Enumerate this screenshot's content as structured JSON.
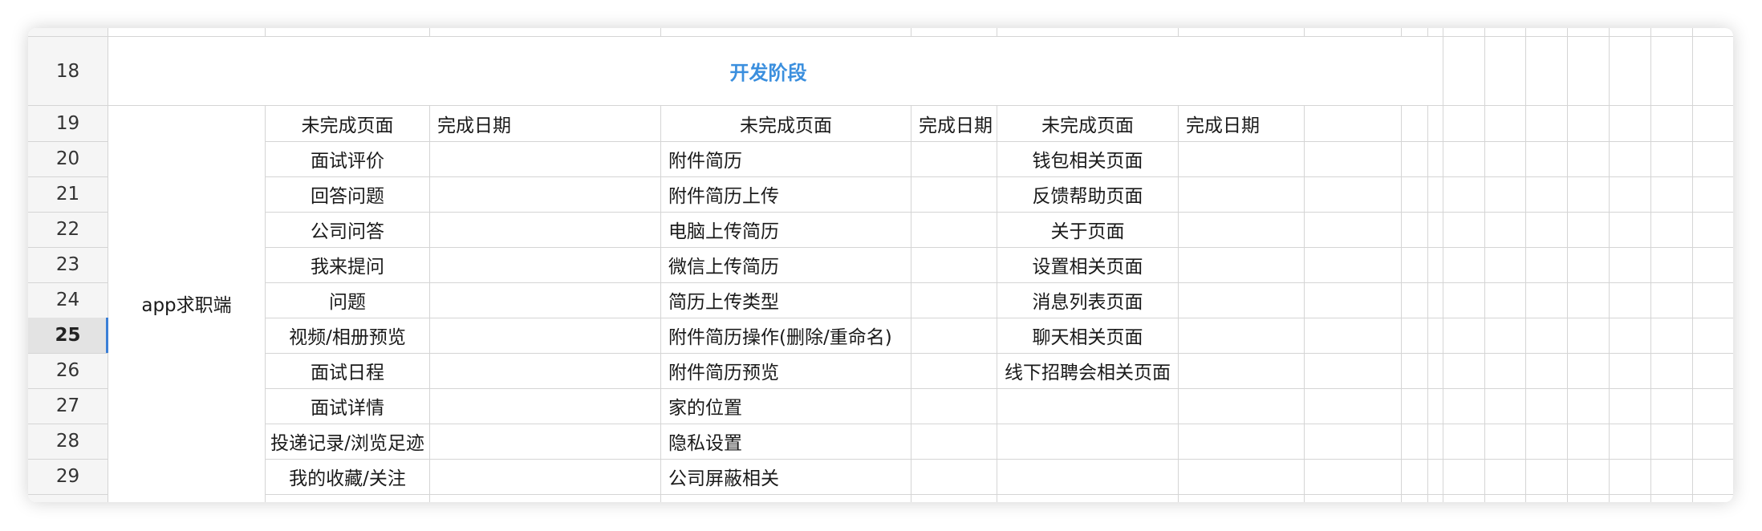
{
  "theme": {
    "accent": "#3b8fde",
    "active_row_marker": "#3b7fd6"
  },
  "sheet": {
    "active_row": "25",
    "phase_title": "开发阶段",
    "group_label": "app求职端",
    "rows": [
      "18",
      "19",
      "20",
      "21",
      "22",
      "23",
      "24",
      "25",
      "26",
      "27",
      "28",
      "29"
    ],
    "headers": [
      "未完成页面",
      "完成日期",
      "未完成页面",
      "完成日期",
      "未完成页面",
      "完成日期"
    ],
    "col1": [
      "面试评价",
      "回答问题",
      "公司问答",
      "我来提问",
      "问题",
      "视频/相册预览",
      "面试日程",
      "面试详情",
      "投递记录/浏览足迹",
      "我的收藏/关注"
    ],
    "col3": [
      "附件简历",
      "附件简历上传",
      "电脑上传简历",
      "微信上传简历",
      "简历上传类型",
      "附件简历操作(删除/重命名)",
      "附件简历预览",
      "家的位置",
      "隐私设置",
      "公司屏蔽相关"
    ],
    "col5": [
      "钱包相关页面",
      "反馈帮助页面",
      "关于页面",
      "设置相关页面",
      "消息列表页面",
      "聊天相关页面",
      "线下招聘会相关页面"
    ]
  }
}
